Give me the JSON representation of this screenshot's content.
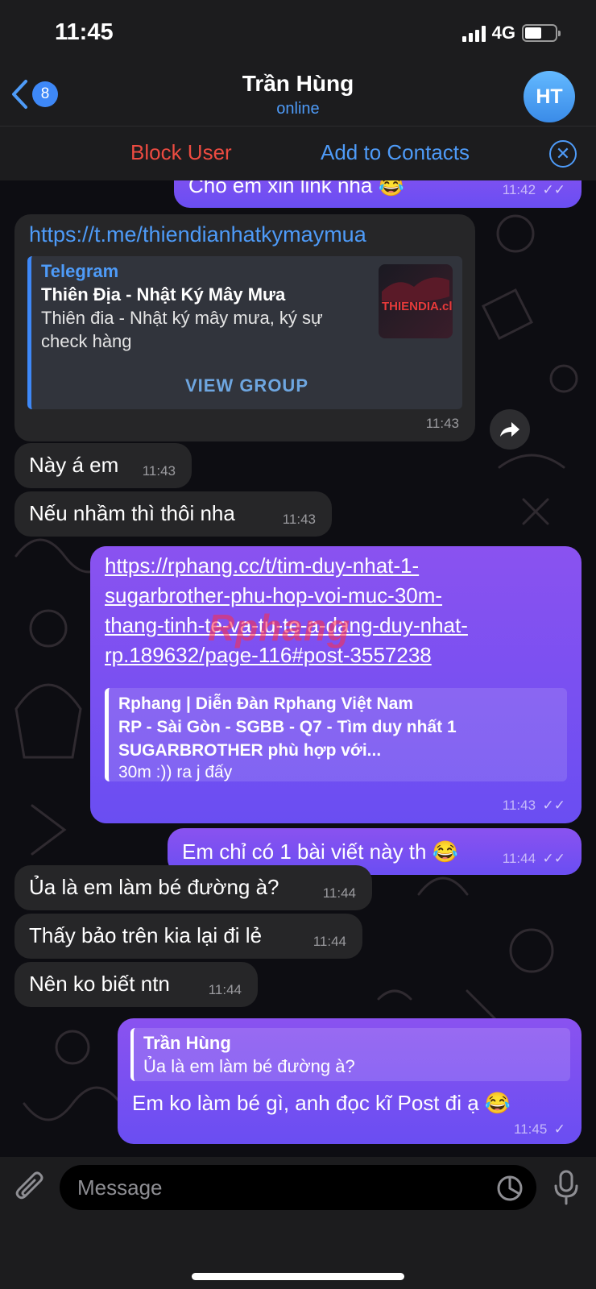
{
  "status": {
    "time": "11:45",
    "network": "4G"
  },
  "header": {
    "back_count": "8",
    "title": "Trần Hùng",
    "subtitle": "online",
    "avatar_initials": "HT"
  },
  "actions": {
    "block": "Block User",
    "add": "Add to Contacts"
  },
  "messages": {
    "m0": {
      "text": "Cho em xin link nha 😂",
      "time": "11:42"
    },
    "m1": {
      "link": "https://t.me/thiendianhatkymaymua",
      "site": "Telegram",
      "title": "Thiên Địa - Nhật Ký Mây Mưa",
      "desc1": "Thiên đia - Nhật ký mây mưa, ký sự",
      "desc2": "check hàng",
      "thumb_text": "THIENDIA.club",
      "button": "VIEW GROUP",
      "time": "11:43"
    },
    "m2": {
      "text": "Này á em",
      "time": "11:43"
    },
    "m3": {
      "text": "Nếu nhầm thì thôi nha",
      "time": "11:43"
    },
    "m4": {
      "link1": "https://rphang.cc/t/tim-duy-nhat-1-",
      "link2": "sugarbrother-phu-hop-voi-muc-30m-",
      "link3": "thang-tinh-te-va-tu-te-a-dang-duy-nhat-",
      "link4": "rp.189632/page-116#post-3557238",
      "title1": "Rphang | Diễn Đàn Rphang Việt Nam",
      "title2": "RP - Sài Gòn - SGBB - Q7 - Tìm duy nhất 1",
      "title3": "SUGARBROTHER phù hợp với...",
      "desc": "30m :)) ra j đấy",
      "time": "11:43"
    },
    "m5": {
      "text": "Em chỉ có 1 bài viết này th 😂",
      "time": "11:44"
    },
    "m6": {
      "text": "Ủa là em làm bé đường à?",
      "time": "11:44"
    },
    "m7": {
      "text": "Thấy bảo trên kia lại đi lẻ",
      "time": "11:44"
    },
    "m8": {
      "text": "Nên ko biết ntn",
      "time": "11:44"
    },
    "m9": {
      "reply_name": "Trần Hùng",
      "reply_text": "Ủa là em làm bé đường à?",
      "text": "Em ko làm bé gì, anh đọc kĩ Post đi ạ 😂",
      "time": "11:45"
    }
  },
  "watermark": "Rphang",
  "input": {
    "placeholder": "Message"
  },
  "colors": {
    "accent": "#4e9bf8",
    "danger": "#ec4b41",
    "outgoing": "#7a50f0",
    "incoming": "#262628"
  }
}
